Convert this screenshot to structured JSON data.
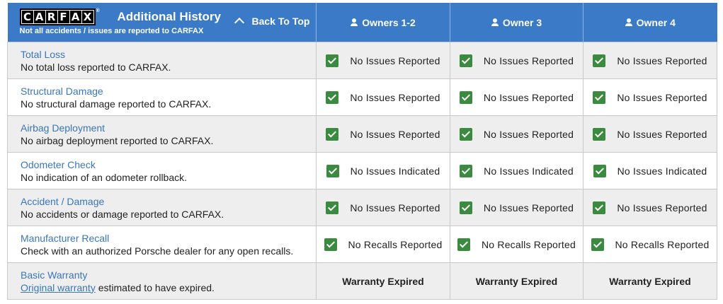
{
  "header": {
    "logo_letters": [
      "C",
      "A",
      "R",
      "F",
      "A",
      "X"
    ],
    "logo_registered": "®",
    "title": "Additional History",
    "subtitle": "Not all accidents / issues are reported to CARFAX",
    "back_to_top": "Back To Top",
    "owners": [
      "Owners 1-2",
      "Owner 3",
      "Owner 4"
    ]
  },
  "colors": {
    "header_bg": "#3b7ac6",
    "link": "#3b76b8",
    "check": "#3a8a3f",
    "row_alt": "#eeeeee"
  },
  "rows": [
    {
      "title": "Total Loss",
      "desc": "No total loss reported to CARFAX.",
      "statuses": [
        "No Issues Reported",
        "No Issues Reported",
        "No Issues Reported"
      ]
    },
    {
      "title": "Structural Damage",
      "desc": "No structural damage reported to CARFAX.",
      "statuses": [
        "No Issues Reported",
        "No Issues Reported",
        "No Issues Reported"
      ]
    },
    {
      "title": "Airbag Deployment",
      "desc": "No airbag deployment reported to CARFAX.",
      "statuses": [
        "No Issues Reported",
        "No Issues Reported",
        "No Issues Reported"
      ]
    },
    {
      "title": "Odometer Check",
      "desc": "No indication of an odometer rollback.",
      "statuses": [
        "No Issues Indicated",
        "No Issues Indicated",
        "No Issues Indicated"
      ]
    },
    {
      "title": "Accident / Damage",
      "desc": "No accidents or damage reported to CARFAX.",
      "statuses": [
        "No Issues Reported",
        "No Issues Reported",
        "No Issues Reported"
      ]
    },
    {
      "title": "Manufacturer Recall",
      "desc": "Check with an authorized Porsche dealer for any open recalls.",
      "statuses": [
        "No Recalls Reported",
        "No Recalls Reported",
        "No Recalls Reported"
      ]
    }
  ],
  "warranty": {
    "title": "Basic Warranty",
    "link": "Original warranty",
    "desc_rest": " estimated to have expired.",
    "statuses": [
      "Warranty Expired",
      "Warranty Expired",
      "Warranty Expired"
    ]
  }
}
